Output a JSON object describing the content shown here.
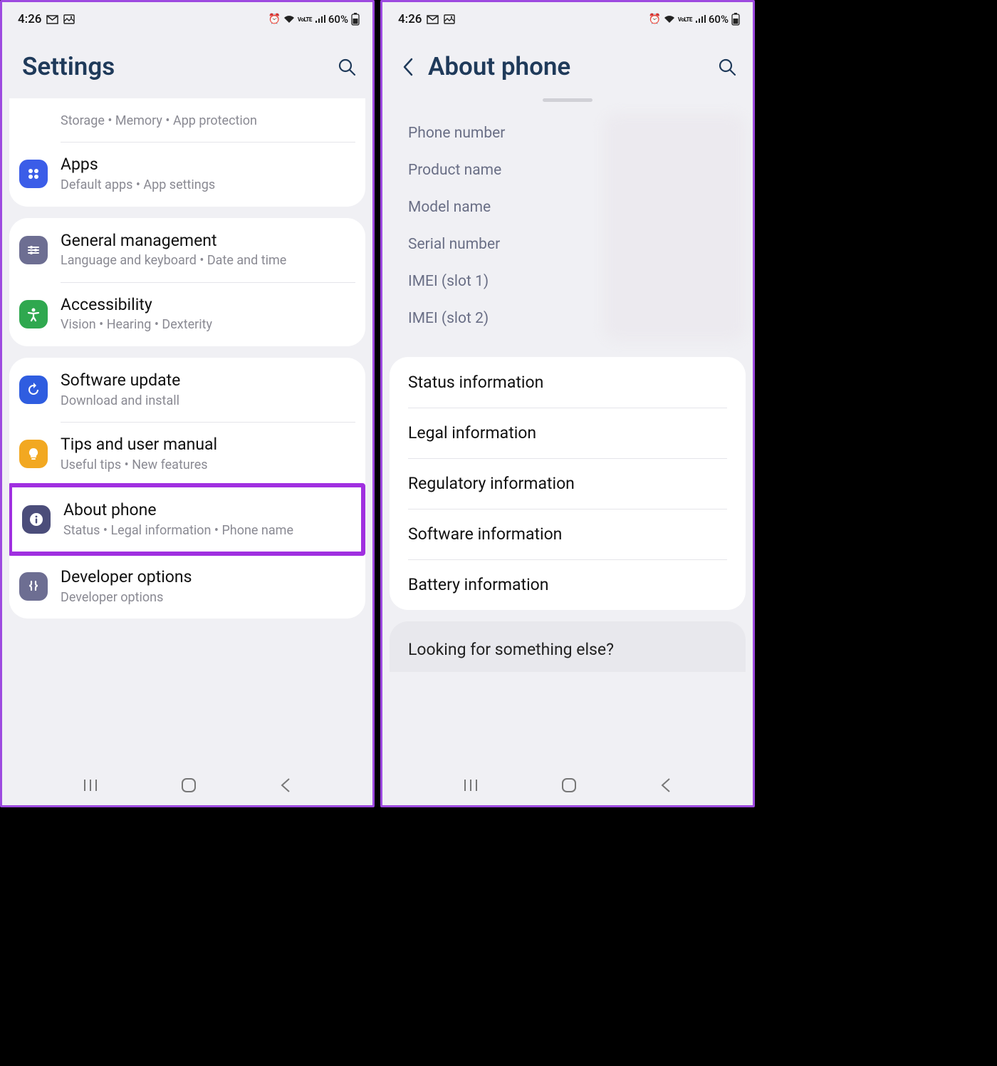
{
  "status": {
    "time": "4:26",
    "icons_left": [
      "gmail-icon",
      "picture-icon"
    ],
    "battery_pct": "60%",
    "signal_text": "VoLTE"
  },
  "left": {
    "title": "Settings",
    "groups": [
      {
        "partial": true,
        "items": [
          {
            "icon": "device-care-icon",
            "color": "#18b59a",
            "title": "",
            "sub": "Storage  •  Memory  •  App protection"
          },
          {
            "icon": "apps-icon",
            "color": "#3b5de8",
            "title": "Apps",
            "sub": "Default apps  •  App settings"
          }
        ]
      },
      {
        "items": [
          {
            "icon": "general-icon",
            "color": "#6d6e92",
            "title": "General management",
            "sub": "Language and keyboard  •  Date and time"
          },
          {
            "icon": "accessibility-icon",
            "color": "#2fa84f",
            "title": "Accessibility",
            "sub": "Vision  •  Hearing  •  Dexterity"
          }
        ]
      },
      {
        "items": [
          {
            "icon": "update-icon",
            "color": "#2f5de0",
            "title": "Software update",
            "sub": "Download and install"
          },
          {
            "icon": "tips-icon",
            "color": "#f2a821",
            "title": "Tips and user manual",
            "sub": "Useful tips  •  New features"
          },
          {
            "icon": "about-icon",
            "color": "#4b4d7a",
            "title": "About phone",
            "sub": "Status  •  Legal information  •  Phone name",
            "highlight": true
          },
          {
            "icon": "dev-icon",
            "color": "#6d6e92",
            "title": "Developer options",
            "sub": "Developer options"
          }
        ]
      }
    ]
  },
  "right": {
    "title": "About phone",
    "info_labels": [
      "Phone number",
      "Product name",
      "Model name",
      "Serial number",
      "IMEI (slot 1)",
      "IMEI (slot 2)"
    ],
    "list": [
      "Status information",
      "Legal information",
      "Regulatory information",
      "Software information",
      "Battery information"
    ],
    "footer": "Looking for something else?"
  }
}
